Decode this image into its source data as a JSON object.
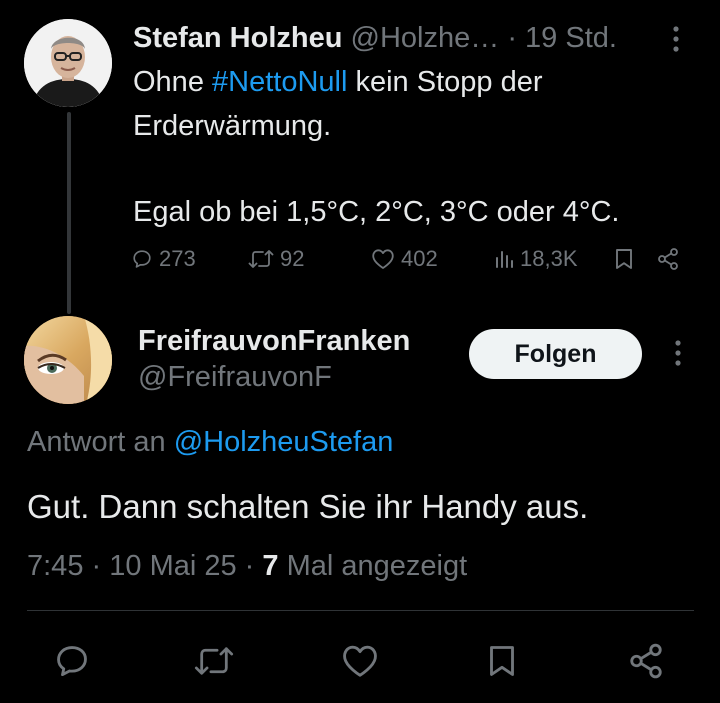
{
  "tweet1": {
    "author_name": "Stefan Holzheu",
    "author_handle": "@Holzhe…",
    "separator": "·",
    "time": "19 Std.",
    "text_before": "Ohne ",
    "hashtag": "#NettoNull",
    "text_after": " kein Stopp der Erderwärmung.",
    "text_second": "Egal ob bei 1,5°C, 2°C, 3°C oder 4°C.",
    "replies": "273",
    "reposts": "92",
    "likes": "402",
    "views": "18,3K"
  },
  "tweet2": {
    "author_name": "FreifrauvonFranken",
    "author_handle": "@FreifrauvonF",
    "follow_label": "Folgen",
    "reply_prefix": "Antwort an ",
    "reply_mention": "@HolzheuStefan",
    "text": "Gut. Dann schalten Sie ihr Handy aus.",
    "time": "7:45",
    "separator": "·",
    "date": "10 Mai 25",
    "view_count": "7",
    "view_suffix": " Mal angezeigt"
  },
  "icons": {
    "reply": "reply-icon",
    "repost": "repost-icon",
    "like": "heart-icon",
    "views": "views-icon",
    "bookmark": "bookmark-icon",
    "share": "share-icon",
    "more": "more-vertical-icon"
  },
  "colors": {
    "background": "#000000",
    "text": "#e7e9ea",
    "muted": "#71767b",
    "accent": "#1d9bf0",
    "button_bg": "#eff3f4"
  }
}
